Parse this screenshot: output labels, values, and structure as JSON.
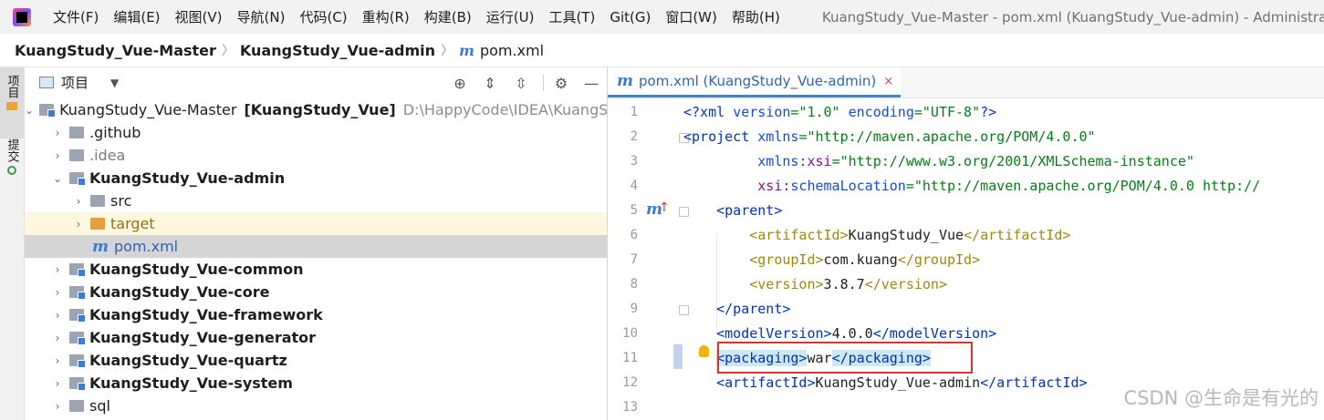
{
  "menubar": {
    "items": [
      "文件(F)",
      "编辑(E)",
      "视图(V)",
      "导航(N)",
      "代码(C)",
      "重构(R)",
      "构建(B)",
      "运行(U)",
      "工具(T)",
      "Git(G)",
      "窗口(W)",
      "帮助(H)"
    ],
    "window_title": "KuangStudy_Vue-Master - pom.xml (KuangStudy_Vue-admin) - Administra"
  },
  "navbar": {
    "crumbs": [
      "KuangStudy_Vue-Master",
      "KuangStudy_Vue-admin"
    ],
    "file_icon": "m",
    "file": "pom.xml"
  },
  "stripe": {
    "project_label": "项目",
    "commit_label": "提交"
  },
  "project": {
    "title": "项目",
    "tree": [
      {
        "name": "KuangStudy_Vue-Master",
        "module": "[KuangStudy_Vue]",
        "path": "D:\\HappyCode\\IDEA\\KuangStu"
      },
      {
        "name": ".github"
      },
      {
        "name": ".idea"
      },
      {
        "name": "KuangStudy_Vue-admin"
      },
      {
        "name": "src"
      },
      {
        "name": "target"
      },
      {
        "name": "pom.xml",
        "icon": "m"
      },
      {
        "name": "KuangStudy_Vue-common"
      },
      {
        "name": "KuangStudy_Vue-core"
      },
      {
        "name": "KuangStudy_Vue-framework"
      },
      {
        "name": "KuangStudy_Vue-generator"
      },
      {
        "name": "KuangStudy_Vue-quartz"
      },
      {
        "name": "KuangStudy_Vue-system"
      },
      {
        "name": "sql"
      }
    ]
  },
  "editor": {
    "tab_icon": "m",
    "tab_label": "pom.xml (KuangStudy_Vue-admin)",
    "tab_close": "×",
    "gutter_marker": "m",
    "line_numbers": [
      "1",
      "2",
      "3",
      "4",
      "5",
      "6",
      "7",
      "8",
      "9",
      "10",
      "11",
      "12",
      "13"
    ],
    "code": {
      "l1_open": "<?xml ",
      "l1_a1": "version",
      "l1_v1": "=\"1.0\" ",
      "l1_a2": "encoding",
      "l1_v2": "=\"UTF-8\"",
      "l1_close": "?>",
      "l2_tag": "<project ",
      "l2_attr": "xmlns",
      "l2_val": "=\"http://maven.apache.org/POM/4.0.0\"",
      "l3_ns": "xmlns:",
      "l3_attr": "xsi",
      "l3_val": "=\"http://www.w3.org/2001/XMLSchema-instance\"",
      "l4_ns": "xsi:",
      "l4_attr": "schemaLocation",
      "l4_val": "=\"http://maven.apache.org/POM/4.0.0 http://",
      "l5": "<parent>",
      "l6_open": "<artifactId>",
      "l6_text": "KuangStudy_Vue",
      "l6_close": "</artifactId>",
      "l7_open": "<groupId>",
      "l7_text": "com.kuang",
      "l7_close": "</groupId>",
      "l8_open": "<version>",
      "l8_text": "3.8.7",
      "l8_close": "</version>",
      "l9": "</parent>",
      "l10_open": "<modelVersion>",
      "l10_text": "4.0.0",
      "l10_close": "</modelVersion>",
      "l11_open": "<packaging>",
      "l11_text": "war",
      "l11_close": "</packaging>",
      "l12_open": "<artifactId>",
      "l12_text": "KuangStudy_Vue-admin",
      "l12_close": "</artifactId>"
    }
  },
  "watermark": "CSDN @生命是有光的"
}
